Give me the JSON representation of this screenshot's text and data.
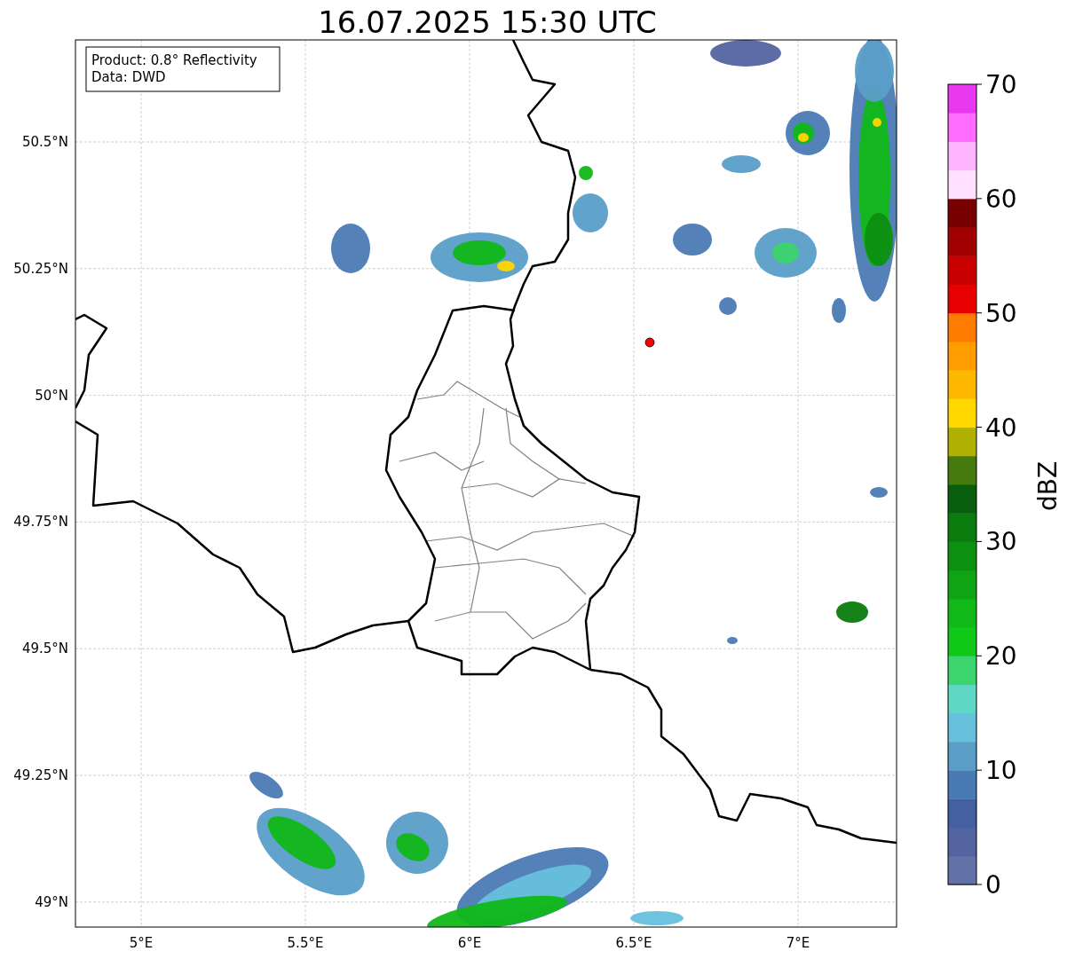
{
  "title": "16.07.2025 15:30 UTC",
  "info_box": [
    "Product: 0.8° Reflectivity",
    "Data: DWD"
  ],
  "map": {
    "xticks": [
      "5°E",
      "5.5°E",
      "6°E",
      "6.5°E",
      "7°E"
    ],
    "yticks": [
      "50.5°N",
      "50.25°N",
      "50°N",
      "49.75°N",
      "49.5°N",
      "49.25°N",
      "49°N"
    ]
  },
  "colorbar": {
    "label": "dBZ",
    "ticks": [
      "70",
      "60",
      "50",
      "40",
      "30",
      "20",
      "10",
      "0"
    ],
    "bands": [
      {
        "color": "#6272a8"
      },
      {
        "color": "#5464a0"
      },
      {
        "color": "#4460a0"
      },
      {
        "color": "#4a7ab4"
      },
      {
        "color": "#5a9ec8"
      },
      {
        "color": "#66c0dc"
      },
      {
        "color": "#5ed8c4"
      },
      {
        "color": "#3cd46c"
      },
      {
        "color": "#10c818"
      },
      {
        "color": "#10b818"
      },
      {
        "color": "#0ea414"
      },
      {
        "color": "#0c9010"
      },
      {
        "color": "#0a7c0e"
      },
      {
        "color": "#085e0c"
      },
      {
        "color": "#467a0e"
      },
      {
        "color": "#b0b000"
      },
      {
        "color": "#ffd800"
      },
      {
        "color": "#ffb800"
      },
      {
        "color": "#ff9c00"
      },
      {
        "color": "#ff7c00"
      },
      {
        "color": "#e80000"
      },
      {
        "color": "#c80000"
      },
      {
        "color": "#a00000"
      },
      {
        "color": "#780000"
      },
      {
        "color": "#ffe0ff"
      },
      {
        "color": "#ffb4ff"
      },
      {
        "color": "#ff6cff"
      },
      {
        "color": "#e838f0"
      }
    ]
  }
}
